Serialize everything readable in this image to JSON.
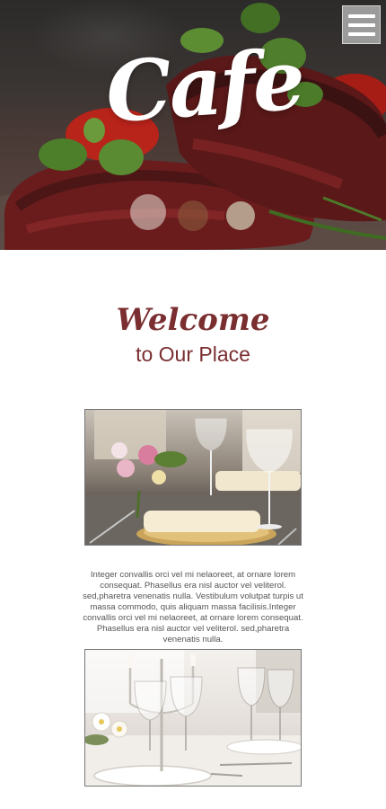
{
  "header": {
    "logo_text": "Cafe",
    "menu_icon": "hamburger-menu-icon"
  },
  "welcome": {
    "title": "Welcome",
    "subtitle": "to Our Place"
  },
  "content": {
    "paragraph": "Integer convallis orci vel mi nelaoreet, at ornare lorem consequat. Phasellus era nisl auctor vel veliterol. sed,pharetra venenatis nulla. Vestibulum volutpat turpis ut massa commodo, quis aliquam massa facilisis.Integer convallis orci vel mi nelaoreet, at ornare lorem consequat. Phasellus era nisl auctor vel veliterol. sed,pharetra venenatis nulla."
  },
  "colors": {
    "accent": "#7a2e30",
    "menu_button": "#9b9b9b",
    "body_text": "#555555"
  }
}
